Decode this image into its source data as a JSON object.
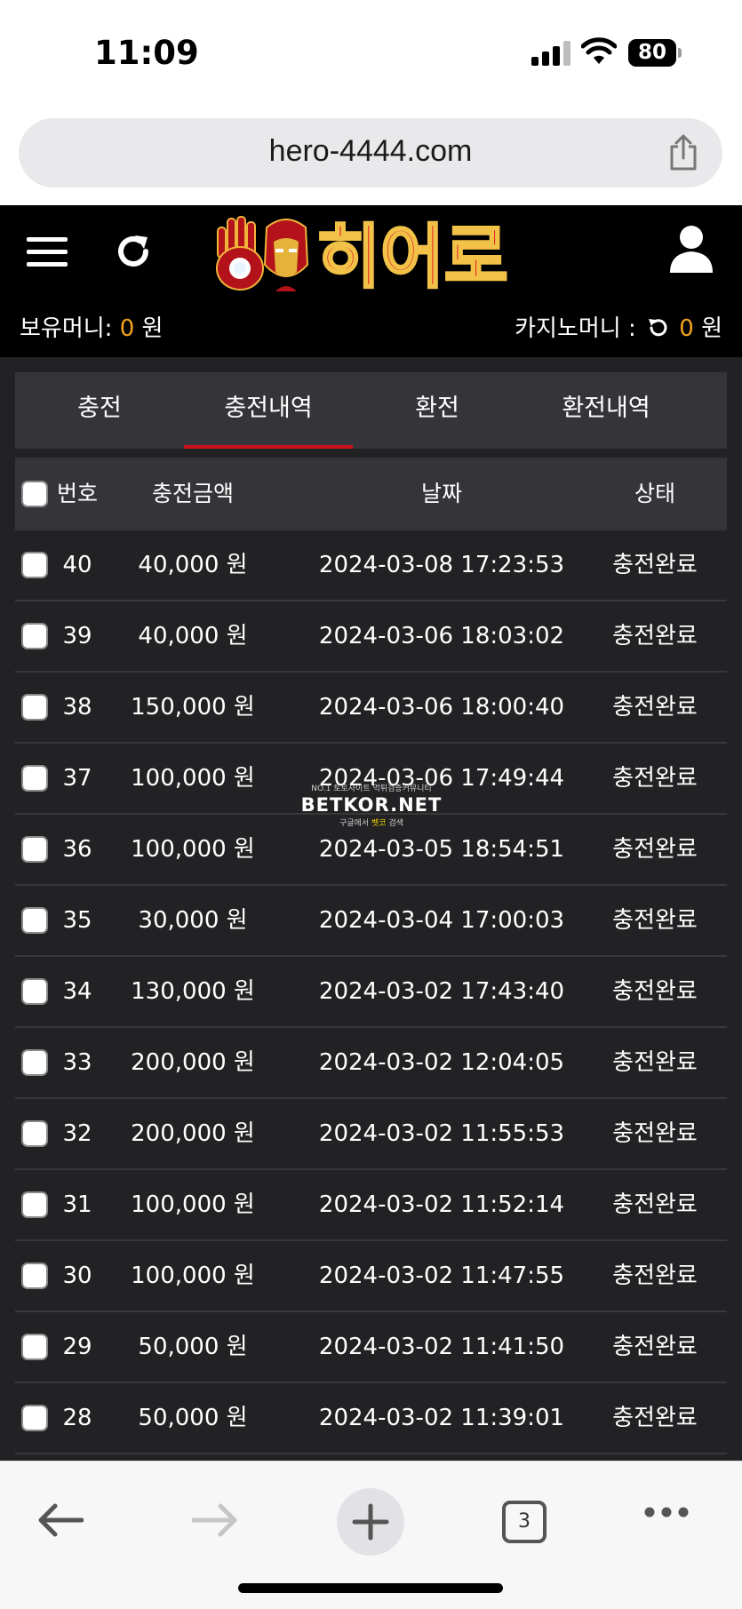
{
  "status_bar": {
    "time": "11:09",
    "battery": "80"
  },
  "browser": {
    "url": "hero-4444.com",
    "tab_count": "3"
  },
  "site": {
    "logo_text": "히어로",
    "holding_money_label": "보유머니:",
    "holding_money_value": "0",
    "casino_money_label": "카지노머니 :",
    "casino_money_value": "0",
    "currency": "원"
  },
  "tabs": [
    {
      "label": "충전"
    },
    {
      "label": "충전내역"
    },
    {
      "label": "환전"
    },
    {
      "label": "환전내역"
    }
  ],
  "active_tab": "충전내역",
  "table": {
    "headers": {
      "number": "번호",
      "amount": "충전금액",
      "date": "날짜",
      "status": "상태"
    },
    "rows": [
      {
        "number": "40",
        "amount": "40,000 원",
        "date": "2024-03-08 17:23:53",
        "status": "충전완료"
      },
      {
        "number": "39",
        "amount": "40,000 원",
        "date": "2024-03-06 18:03:02",
        "status": "충전완료"
      },
      {
        "number": "38",
        "amount": "150,000 원",
        "date": "2024-03-06 18:00:40",
        "status": "충전완료"
      },
      {
        "number": "37",
        "amount": "100,000 원",
        "date": "2024-03-06 17:49:44",
        "status": "충전완료"
      },
      {
        "number": "36",
        "amount": "100,000 원",
        "date": "2024-03-05 18:54:51",
        "status": "충전완료"
      },
      {
        "number": "35",
        "amount": "30,000 원",
        "date": "2024-03-04 17:00:03",
        "status": "충전완료"
      },
      {
        "number": "34",
        "amount": "130,000 원",
        "date": "2024-03-02 17:43:40",
        "status": "충전완료"
      },
      {
        "number": "33",
        "amount": "200,000 원",
        "date": "2024-03-02 12:04:05",
        "status": "충전완료"
      },
      {
        "number": "32",
        "amount": "200,000 원",
        "date": "2024-03-02 11:55:53",
        "status": "충전완료"
      },
      {
        "number": "31",
        "amount": "100,000 원",
        "date": "2024-03-02 11:52:14",
        "status": "충전완료"
      },
      {
        "number": "30",
        "amount": "100,000 원",
        "date": "2024-03-02 11:47:55",
        "status": "충전완료"
      },
      {
        "number": "29",
        "amount": "50,000 원",
        "date": "2024-03-02 11:41:50",
        "status": "충전완료"
      },
      {
        "number": "28",
        "amount": "50,000 원",
        "date": "2024-03-02 11:39:01",
        "status": "충전완료"
      }
    ]
  },
  "watermark": {
    "tagline": "NO.1 토토사이트 먹튀검증커뮤니티",
    "brand": "BETKOR.NET",
    "search_prefix": "구글에서",
    "search_term": "벳코",
    "search_suffix": "검색"
  },
  "colors": {
    "accent_red": "#c8131d",
    "amount_orange": "#f4a21c",
    "background": "#222225"
  }
}
